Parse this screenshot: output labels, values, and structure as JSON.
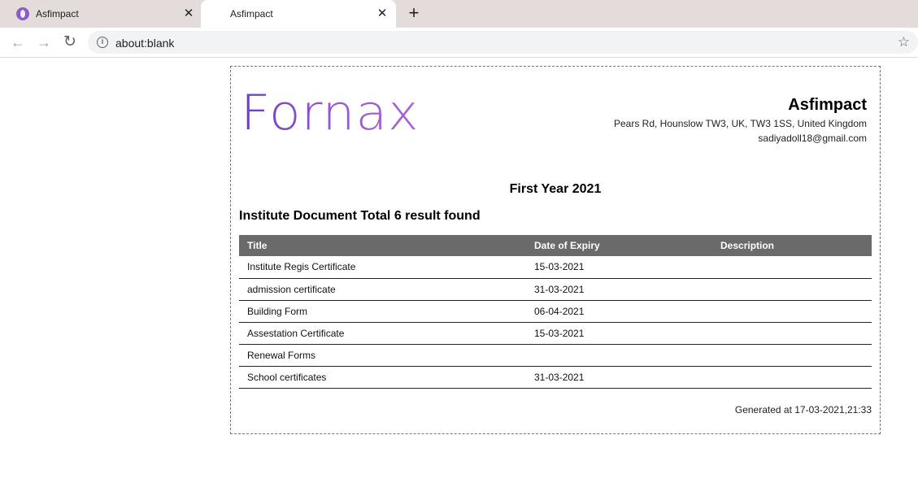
{
  "browser": {
    "tabs": [
      {
        "title": "Asfimpact",
        "active": false
      },
      {
        "title": "Asfimpact",
        "active": true
      }
    ],
    "close_glyph": "✕",
    "new_tab_glyph": "+",
    "url": "about:blank"
  },
  "report": {
    "logo_text": "Fornax",
    "company": "Asfimpact",
    "address": "Pears Rd, Hounslow TW3, UK, TW3 1SS, United Kingdom",
    "email": "sadiyadoll18@gmail.com",
    "title": "First Year 2021",
    "section_heading": "Institute Document Total 6 result found",
    "table": {
      "headers": [
        "Title",
        "Date of Expiry",
        "Description"
      ],
      "rows": [
        [
          "Institute Regis Certificate",
          "15-03-2021",
          ""
        ],
        [
          "admission certificate",
          "31-03-2021",
          ""
        ],
        [
          "Building Form",
          "06-04-2021",
          ""
        ],
        [
          "Assestation Certificate",
          "15-03-2021",
          ""
        ],
        [
          "Renewal Forms",
          "",
          ""
        ],
        [
          "School certificates",
          "31-03-2021",
          ""
        ]
      ]
    },
    "generated": "Generated at 17-03-2021,21:33"
  },
  "colors": {
    "accent": "#8a5bc9",
    "table_header": "#6a6a6a"
  }
}
